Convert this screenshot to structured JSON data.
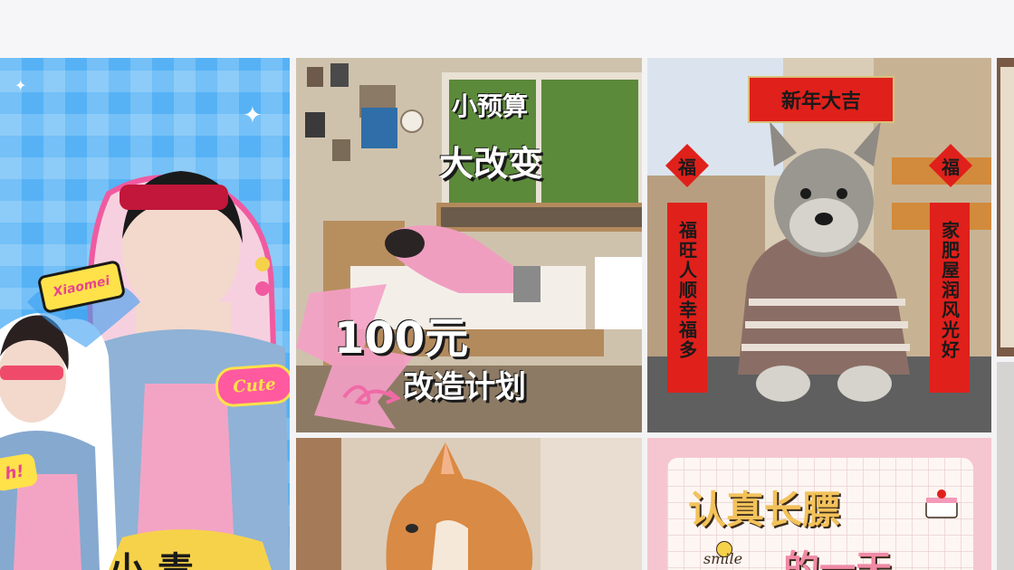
{
  "tiles": {
    "fashion": {
      "badge_name": "Xiaomei",
      "badge_cute": "Cute",
      "badge_partial": "h!",
      "partial_title": "小 青"
    },
    "room": {
      "line1": "小预算",
      "line2": "大改变",
      "line3": "100元",
      "line4": "改造计划"
    },
    "dog": {
      "banner": "新年大吉",
      "fu_left": "福",
      "fu_right": "福",
      "couplet_left": "福旺人顺幸福多",
      "couplet_right": "家肥屋润风光好"
    },
    "card": {
      "title": "认真长膘",
      "subtitle": "的一天",
      "smile": "smile"
    }
  },
  "colors": {
    "red": "#e0201b",
    "pink": "#f2a1c0",
    "blue": "#4aa9f0",
    "gold": "#f6c24a"
  }
}
